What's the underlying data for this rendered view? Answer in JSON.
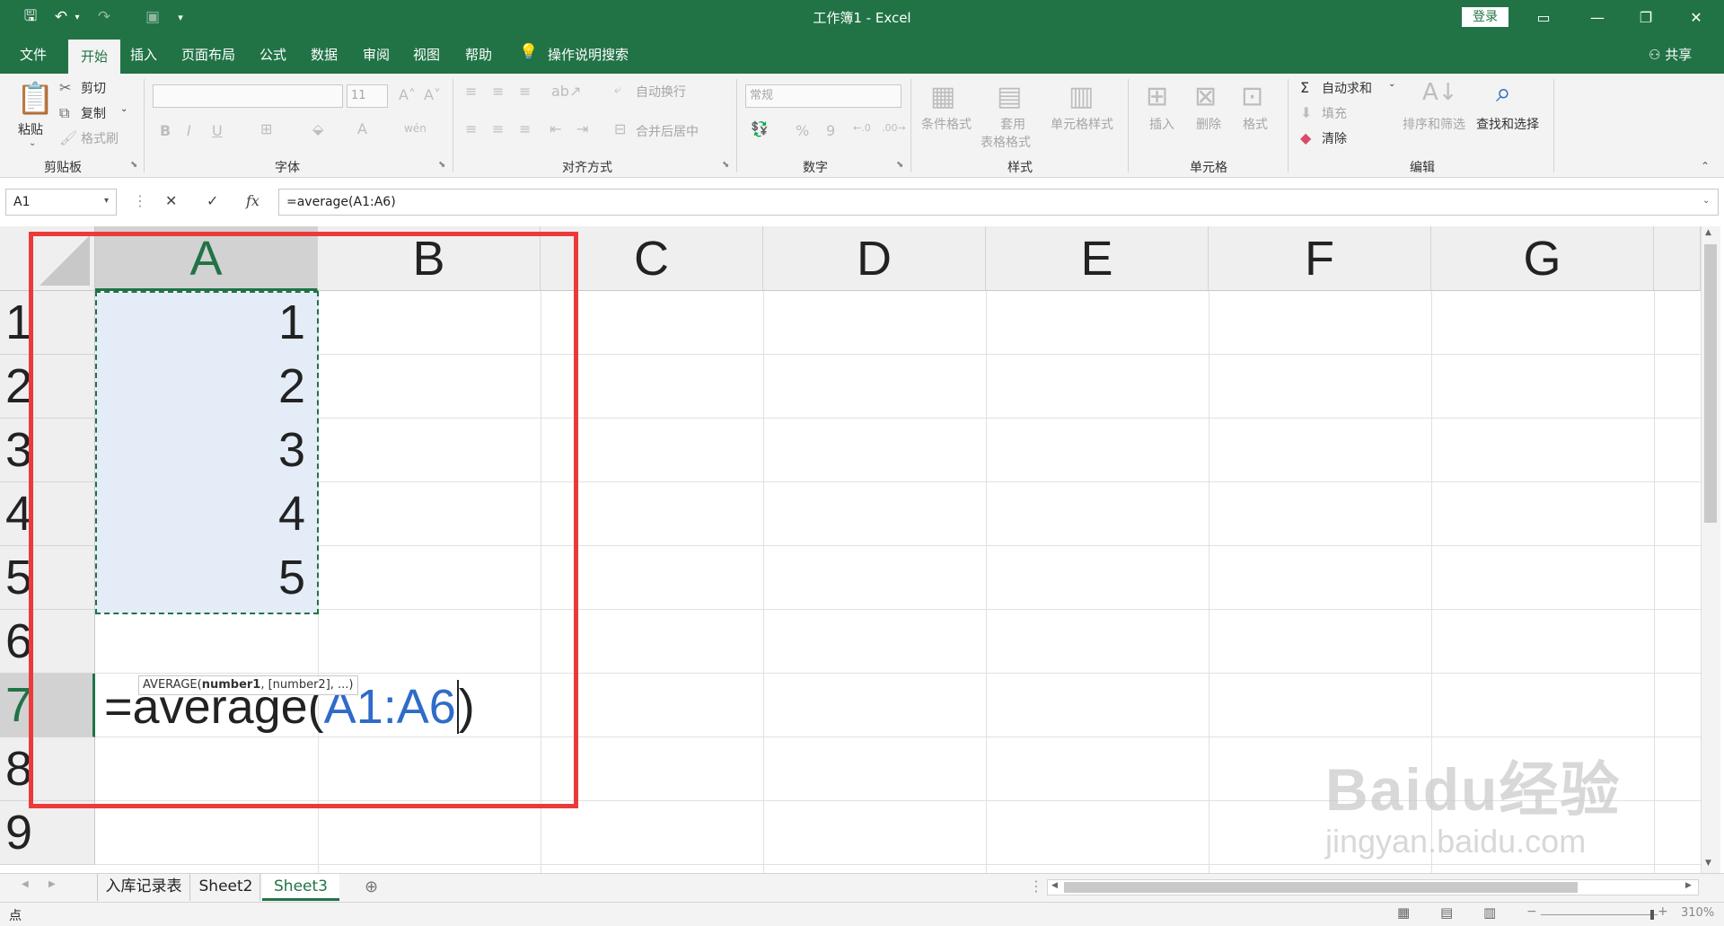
{
  "titlebar": {
    "title": "工作簿1  -  Excel",
    "login_label": "登录",
    "quick_access": [
      "save-icon",
      "undo-icon",
      "redo-icon",
      "touch-mode-icon",
      "customize-icon"
    ],
    "window_buttons": [
      "ribbon-display-icon",
      "minimize-icon",
      "restore-icon",
      "close-icon"
    ]
  },
  "tabs": {
    "file": "文件",
    "home": "开始",
    "insert": "插入",
    "page_layout": "页面布局",
    "formulas": "公式",
    "data": "数据",
    "review": "审阅",
    "view": "视图",
    "help": "帮助",
    "tell_me": "操作说明搜索",
    "share": "共享"
  },
  "ribbon": {
    "clipboard": {
      "paste": "粘贴",
      "cut": "剪切",
      "copy": "复制",
      "format_painter": "格式刷",
      "label": "剪贴板"
    },
    "font": {
      "font_size": "11",
      "bold": "B",
      "italic": "I",
      "underline": "U",
      "font_color": "A",
      "phonetic": "wén",
      "label": "字体"
    },
    "alignment": {
      "wrap_text": "自动换行",
      "merge_center": "合并后居中",
      "label": "对齐方式"
    },
    "number": {
      "format": "常规",
      "percent": "%",
      "comma": "9",
      "label": "数字"
    },
    "styles": {
      "conditional": "条件格式",
      "format_table_1": "套用",
      "format_table_2": "表格格式",
      "cell_styles": "单元格样式",
      "label": "样式"
    },
    "cells": {
      "insert": "插入",
      "delete": "删除",
      "format": "格式",
      "label": "单元格"
    },
    "editing": {
      "autosum": "自动求和",
      "fill": "填充",
      "clear": "清除",
      "sort_filter": "排序和筛选",
      "find_select": "查找和选择",
      "label": "编辑"
    }
  },
  "formula_bar": {
    "name_box": "A1",
    "cancel": "✕",
    "enter": "✓",
    "fx": "fx",
    "formula": "=average(A1:A6)"
  },
  "sheet": {
    "columns": [
      "A",
      "B",
      "C",
      "D",
      "E",
      "F",
      "G"
    ],
    "selected_column": "A",
    "rows": [
      "1",
      "2",
      "3",
      "4",
      "5",
      "6",
      "7",
      "8",
      "9"
    ],
    "active_row": "7",
    "cells": {
      "A1": "1",
      "A2": "2",
      "A3": "3",
      "A4": "4",
      "A5": "5"
    },
    "editing": {
      "prefix": "=average(",
      "range": "A1:A6",
      "suffix": ")"
    },
    "tooltip": {
      "func": "AVERAGE(",
      "arg1": "number1",
      "rest": ", [number2], ...)"
    }
  },
  "sheet_tabs": [
    "入库记录表",
    "Sheet2",
    "Sheet3"
  ],
  "active_sheet": "Sheet3",
  "status": {
    "mode": "点",
    "zoom": "310%"
  },
  "watermark": {
    "logo": "Baidu经验",
    "url": "jingyan.baidu.com"
  },
  "colors": {
    "excel_green": "#217346",
    "highlight_red": "#ec3a3a",
    "range_blue": "#2f6cc8",
    "copy_fill": "#e4ecf7"
  }
}
